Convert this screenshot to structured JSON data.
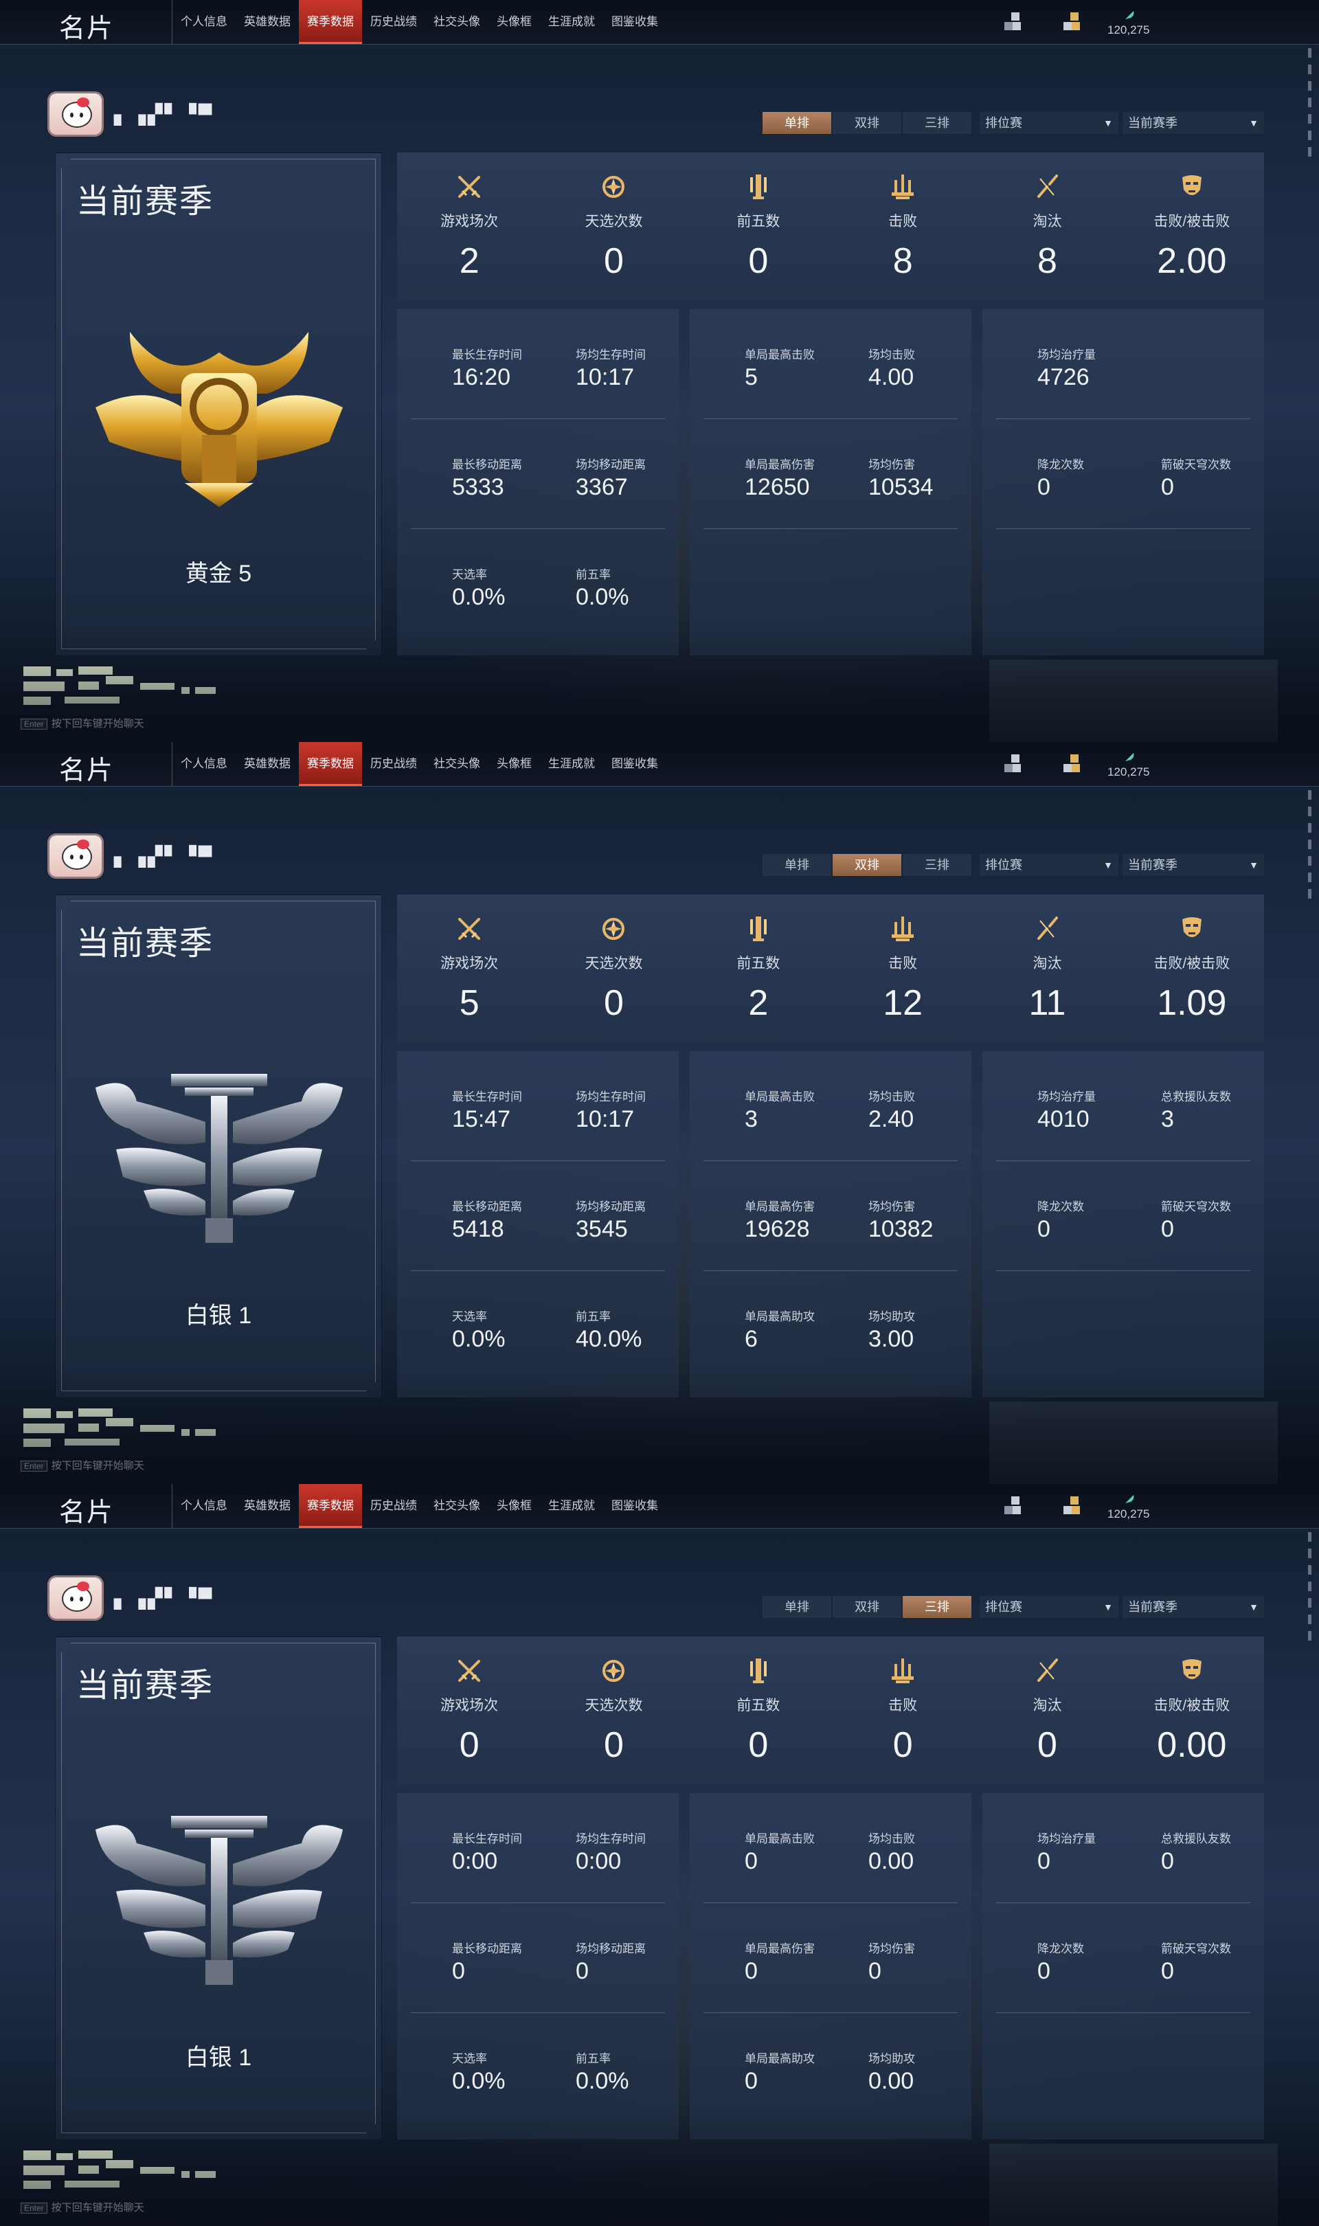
{
  "header": {
    "title": "名片",
    "nav": [
      "个人信息",
      "英雄数据",
      "赛季数据",
      "历史战绩",
      "社交头像",
      "头像框",
      "生涯成就",
      "图鉴收集"
    ],
    "active_nav": "赛季数据",
    "currency": "120,275"
  },
  "filters": {
    "mode_tabs": [
      "单排",
      "双排",
      "三排"
    ],
    "match_type": "排位赛",
    "season": "当前赛季"
  },
  "chat_hint": {
    "key": "Enter",
    "text": "按下回车键开始聊天"
  },
  "panels": [
    {
      "active_mode": "单排",
      "season_title": "当前赛季",
      "rank_name": "黄金 5",
      "rank_tier": "gold",
      "summary": [
        {
          "icon": "crossed-swords-icon",
          "label": "游戏场次",
          "value": "2"
        },
        {
          "icon": "flame-emblem-icon",
          "label": "天选次数",
          "value": "0"
        },
        {
          "icon": "sword-pillar-icon",
          "label": "前五数",
          "value": "0"
        },
        {
          "icon": "trident-icon",
          "label": "击败",
          "value": "8"
        },
        {
          "icon": "broken-sword-icon",
          "label": "淘汰",
          "value": "8"
        },
        {
          "icon": "mask-icon",
          "label": "击败/被击败",
          "value": "2.00"
        }
      ],
      "cards": [
        [
          [
            {
              "label": "最长生存时间",
              "value": "16:20"
            },
            {
              "label": "场均生存时间",
              "value": "10:17"
            }
          ],
          [
            {
              "label": "最长移动距离",
              "value": "5333"
            },
            {
              "label": "场均移动距离",
              "value": "3367"
            }
          ],
          [
            {
              "label": "天选率",
              "value": "0.0%"
            },
            {
              "label": "前五率",
              "value": "0.0%"
            }
          ]
        ],
        [
          [
            {
              "label": "单局最高击败",
              "value": "5"
            },
            {
              "label": "场均击败",
              "value": "4.00"
            }
          ],
          [
            {
              "label": "单局最高伤害",
              "value": "12650"
            },
            {
              "label": "场均伤害",
              "value": "10534"
            }
          ],
          [
            {
              "label": "",
              "value": ""
            },
            {
              "label": "",
              "value": ""
            }
          ]
        ],
        [
          [
            {
              "label": "场均治疗量",
              "value": "4726"
            },
            {
              "label": "",
              "value": ""
            }
          ],
          [
            {
              "label": "降龙次数",
              "value": "0"
            },
            {
              "label": "箭破天穹次数",
              "value": "0"
            }
          ],
          [
            {
              "label": "",
              "value": ""
            },
            {
              "label": "",
              "value": ""
            }
          ]
        ]
      ]
    },
    {
      "active_mode": "双排",
      "season_title": "当前赛季",
      "rank_name": "白银 1",
      "rank_tier": "silver",
      "summary": [
        {
          "icon": "crossed-swords-icon",
          "label": "游戏场次",
          "value": "5"
        },
        {
          "icon": "flame-emblem-icon",
          "label": "天选次数",
          "value": "0"
        },
        {
          "icon": "sword-pillar-icon",
          "label": "前五数",
          "value": "2"
        },
        {
          "icon": "trident-icon",
          "label": "击败",
          "value": "12"
        },
        {
          "icon": "broken-sword-icon",
          "label": "淘汰",
          "value": "11"
        },
        {
          "icon": "mask-icon",
          "label": "击败/被击败",
          "value": "1.09"
        }
      ],
      "cards": [
        [
          [
            {
              "label": "最长生存时间",
              "value": "15:47"
            },
            {
              "label": "场均生存时间",
              "value": "10:17"
            }
          ],
          [
            {
              "label": "最长移动距离",
              "value": "5418"
            },
            {
              "label": "场均移动距离",
              "value": "3545"
            }
          ],
          [
            {
              "label": "天选率",
              "value": "0.0%"
            },
            {
              "label": "前五率",
              "value": "40.0%"
            }
          ]
        ],
        [
          [
            {
              "label": "单局最高击败",
              "value": "3"
            },
            {
              "label": "场均击败",
              "value": "2.40"
            }
          ],
          [
            {
              "label": "单局最高伤害",
              "value": "19628"
            },
            {
              "label": "场均伤害",
              "value": "10382"
            }
          ],
          [
            {
              "label": "单局最高助攻",
              "value": "6"
            },
            {
              "label": "场均助攻",
              "value": "3.00"
            }
          ]
        ],
        [
          [
            {
              "label": "场均治疗量",
              "value": "4010"
            },
            {
              "label": "总救援队友数",
              "value": "3"
            }
          ],
          [
            {
              "label": "降龙次数",
              "value": "0"
            },
            {
              "label": "箭破天穹次数",
              "value": "0"
            }
          ],
          [
            {
              "label": "",
              "value": ""
            },
            {
              "label": "",
              "value": ""
            }
          ]
        ]
      ]
    },
    {
      "active_mode": "三排",
      "season_title": "当前赛季",
      "rank_name": "白银 1",
      "rank_tier": "silver",
      "summary": [
        {
          "icon": "crossed-swords-icon",
          "label": "游戏场次",
          "value": "0"
        },
        {
          "icon": "flame-emblem-icon",
          "label": "天选次数",
          "value": "0"
        },
        {
          "icon": "sword-pillar-icon",
          "label": "前五数",
          "value": "0"
        },
        {
          "icon": "trident-icon",
          "label": "击败",
          "value": "0"
        },
        {
          "icon": "broken-sword-icon",
          "label": "淘汰",
          "value": "0"
        },
        {
          "icon": "mask-icon",
          "label": "击败/被击败",
          "value": "0.00"
        }
      ],
      "cards": [
        [
          [
            {
              "label": "最长生存时间",
              "value": "0:00"
            },
            {
              "label": "场均生存时间",
              "value": "0:00"
            }
          ],
          [
            {
              "label": "最长移动距离",
              "value": "0"
            },
            {
              "label": "场均移动距离",
              "value": "0"
            }
          ],
          [
            {
              "label": "天选率",
              "value": "0.0%"
            },
            {
              "label": "前五率",
              "value": "0.0%"
            }
          ]
        ],
        [
          [
            {
              "label": "单局最高击败",
              "value": "0"
            },
            {
              "label": "场均击败",
              "value": "0.00"
            }
          ],
          [
            {
              "label": "单局最高伤害",
              "value": "0"
            },
            {
              "label": "场均伤害",
              "value": "0"
            }
          ],
          [
            {
              "label": "单局最高助攻",
              "value": "0"
            },
            {
              "label": "场均助攻",
              "value": "0.00"
            }
          ]
        ],
        [
          [
            {
              "label": "场均治疗量",
              "value": "0"
            },
            {
              "label": "总救援队友数",
              "value": "0"
            }
          ],
          [
            {
              "label": "降龙次数",
              "value": "0"
            },
            {
              "label": "箭破天穹次数",
              "value": "0"
            }
          ],
          [
            {
              "label": "",
              "value": ""
            },
            {
              "label": "",
              "value": ""
            }
          ]
        ]
      ]
    }
  ]
}
